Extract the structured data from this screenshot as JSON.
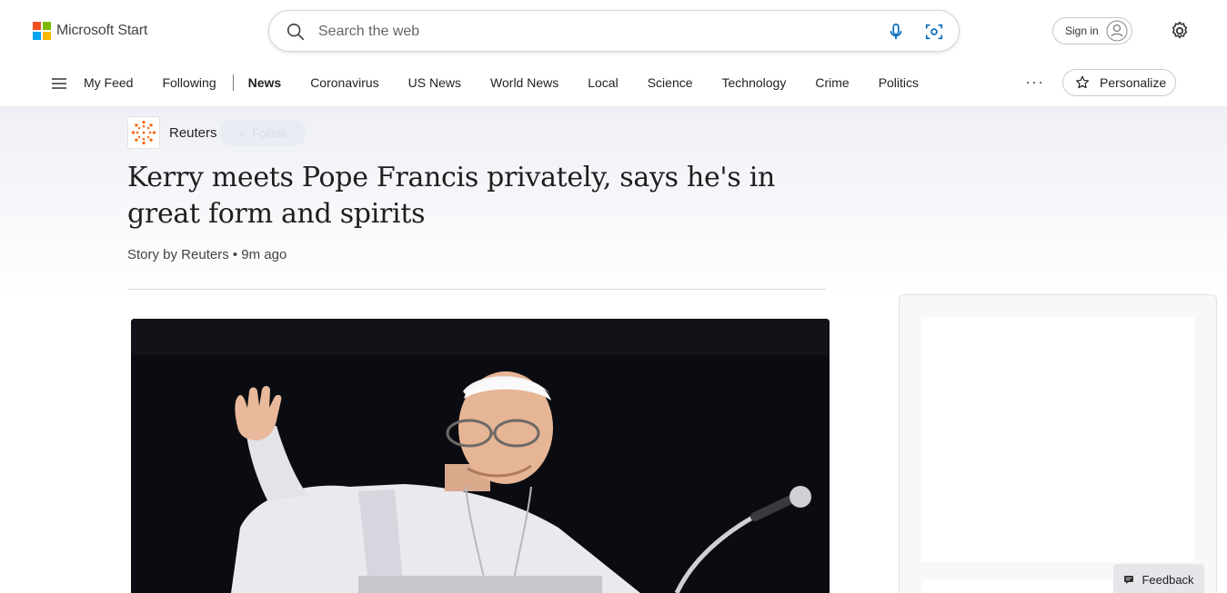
{
  "brand": {
    "name": "Microsoft Start"
  },
  "search": {
    "placeholder": "Search the web"
  },
  "header": {
    "sign_in_label": "Sign in"
  },
  "nav": {
    "items": [
      {
        "label": "My Feed"
      },
      {
        "label": "Following"
      },
      {
        "label": "News"
      },
      {
        "label": "Coronavirus"
      },
      {
        "label": "US News"
      },
      {
        "label": "World News"
      },
      {
        "label": "Local"
      },
      {
        "label": "Science"
      },
      {
        "label": "Technology"
      },
      {
        "label": "Crime"
      },
      {
        "label": "Politics"
      }
    ],
    "active": "News",
    "more_label": "···",
    "personalize_label": "Personalize"
  },
  "article": {
    "publisher": "Reuters",
    "follow_label": "Follow",
    "headline": "Kerry meets Pope Francis privately, says he's in great form and spirits",
    "byline": "Story by Reuters • 9m ago"
  },
  "feedback": {
    "label": "Feedback"
  },
  "colors": {
    "ms_red": "#f25022",
    "ms_green": "#7fba00",
    "ms_blue": "#00a4ef",
    "ms_yellow": "#ffb900",
    "accent": "#0067b8",
    "reuters_orange": "#fa6400"
  }
}
